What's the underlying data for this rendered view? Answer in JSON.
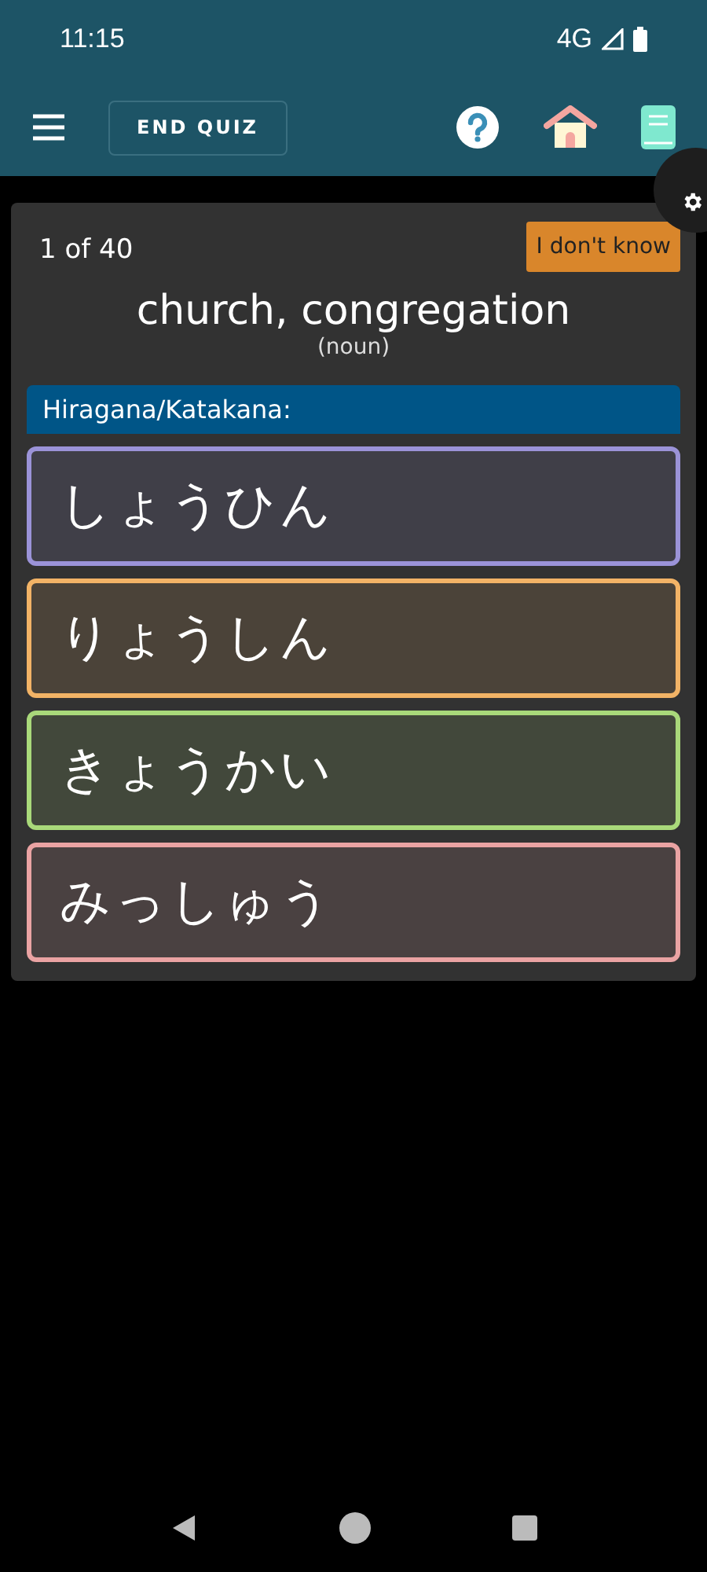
{
  "status_bar": {
    "time": "11:15",
    "network": "4G"
  },
  "toolbar": {
    "end_button": "END QUIZ"
  },
  "quiz": {
    "progress": "1 of 40",
    "skip_button": "I don't know",
    "prompt": "church, congregation",
    "part_of_speech": "(noun)",
    "answer_header": "Hiragana/Katakana:",
    "answers": [
      {
        "text": "しょうひん",
        "color": "#9b93d8"
      },
      {
        "text": "りょうしん",
        "color": "#f2b366"
      },
      {
        "text": "きょうかい",
        "color": "#a9d97a"
      },
      {
        "text": "みっしゅう",
        "color": "#eaa3a3"
      }
    ]
  }
}
